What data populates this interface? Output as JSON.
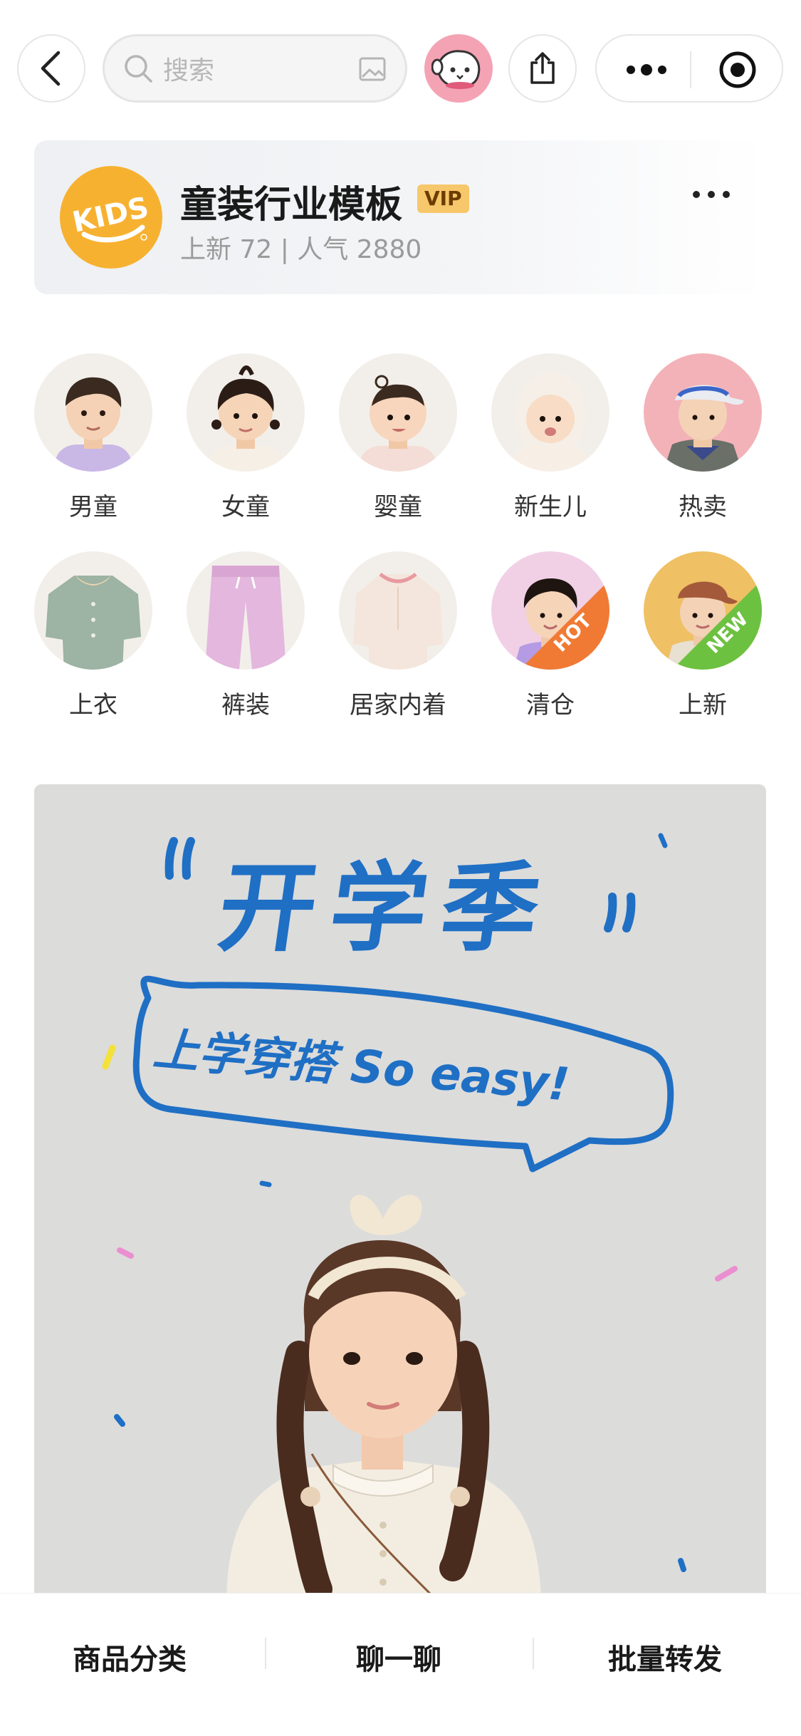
{
  "search": {
    "placeholder": "搜索"
  },
  "shop": {
    "name": "童装行业模板",
    "badge": "VIP",
    "logo_text": "KIDS",
    "stats": "上新 72 | 人气 2880"
  },
  "categories": [
    {
      "label": "男童",
      "tag": ""
    },
    {
      "label": "女童",
      "tag": ""
    },
    {
      "label": "婴童",
      "tag": ""
    },
    {
      "label": "新生儿",
      "tag": ""
    },
    {
      "label": "热卖",
      "tag": ""
    },
    {
      "label": "上衣",
      "tag": ""
    },
    {
      "label": "裤装",
      "tag": ""
    },
    {
      "label": "居家内着",
      "tag": ""
    },
    {
      "label": "清仓",
      "tag": "HOT"
    },
    {
      "label": "上新",
      "tag": "NEW"
    }
  ],
  "banner": {
    "headline": "开学季",
    "bubble_text": "上学穿搭 So easy!"
  },
  "bottom_bar": {
    "items": [
      "商品分类",
      "聊一聊",
      "批量转发"
    ]
  },
  "colors": {
    "accent_blue": "#1f6fc4",
    "vip_gold": "#f7c76b",
    "logo_orange": "#f7b131",
    "hot_orange": "#f07a34",
    "new_green": "#6cc140"
  }
}
